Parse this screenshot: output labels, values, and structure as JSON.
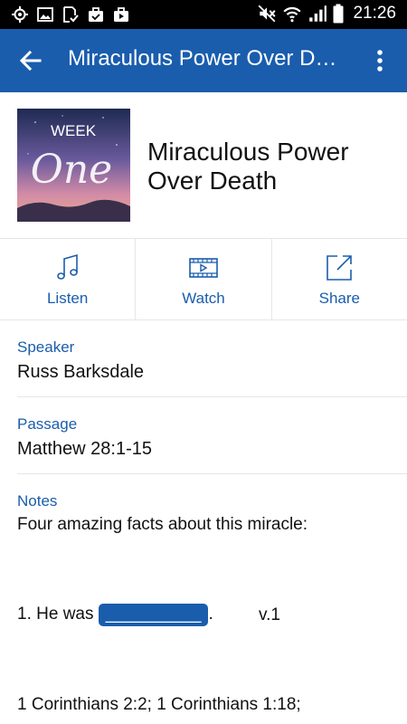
{
  "status_bar": {
    "time": "21:26",
    "left_icons": [
      "location-icon",
      "image-icon",
      "download-done-icon",
      "briefcase-check-icon",
      "briefcase-play-icon"
    ],
    "right_icons": [
      "mute-icon",
      "wifi-icon",
      "signal-icon",
      "battery-icon"
    ]
  },
  "app_bar": {
    "title": "Miraculous Power Over Death",
    "background": "#1a5dad"
  },
  "header": {
    "artwork_text_top": "WEEK",
    "artwork_text_script": "One",
    "title": "Miraculous Power Over Death"
  },
  "actions": [
    {
      "label": "Listen",
      "icon": "music-note-icon"
    },
    {
      "label": "Watch",
      "icon": "video-icon"
    },
    {
      "label": "Share",
      "icon": "share-external-icon"
    }
  ],
  "details": {
    "speaker_label": "Speaker",
    "speaker": "Russ Barksdale",
    "passage_label": "Passage",
    "passage": "Matthew 28:1-15"
  },
  "notes": {
    "label": "Notes",
    "intro": "Four amazing facts about this miracle:",
    "point1_prefix": "1. He was ",
    "point1_blank": "__________",
    "point1_suffix": ".",
    "point1_ref": "v.1",
    "refs": "1 Corinthians 2:2; 1 Corinthians 1:18;"
  },
  "colors": {
    "accent": "#1a5dad",
    "divider": "#e6e6e6",
    "status_bar": "#000000"
  }
}
